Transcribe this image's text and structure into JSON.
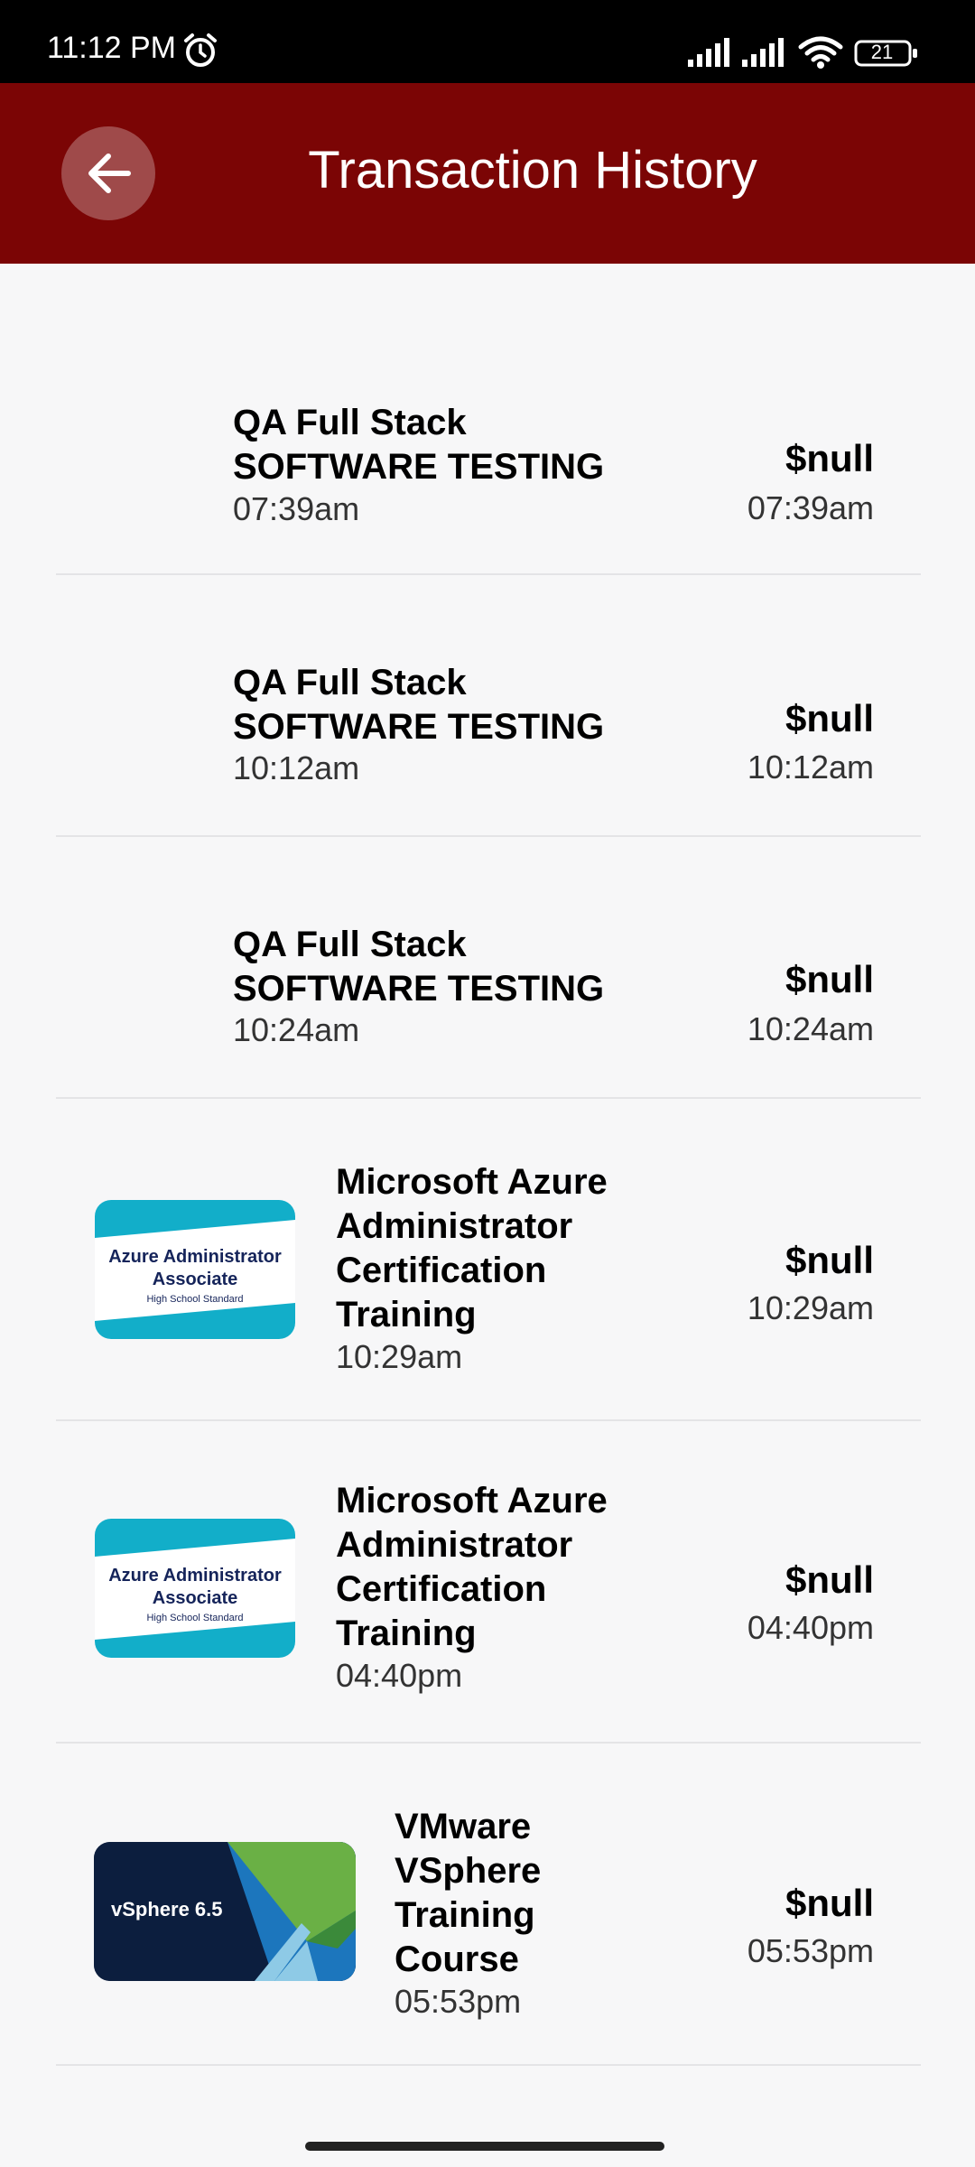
{
  "status_bar": {
    "time": "11:12 PM",
    "battery": "21",
    "icons": [
      "alarm-icon",
      "signal-icon",
      "signal-icon",
      "wifi-icon",
      "battery-icon"
    ]
  },
  "header": {
    "title": "Transaction History",
    "back_icon": "arrow-left-icon",
    "color": "#7b0505"
  },
  "transactions": [
    {
      "title": "QA Full Stack SOFTWARE TESTING",
      "time": "07:39am",
      "price": "$null",
      "right_time": "07:39am",
      "thumbnail": null
    },
    {
      "title": "QA Full Stack SOFTWARE TESTING",
      "time": "10:12am",
      "price": "$null",
      "right_time": "10:12am",
      "thumbnail": null
    },
    {
      "title": "QA Full Stack SOFTWARE TESTING",
      "time": "10:24am",
      "price": "$null",
      "right_time": "10:24am",
      "thumbnail": null
    },
    {
      "title": "Microsoft Azure Administrator Certification Training",
      "time": "10:29am",
      "price": "$null",
      "right_time": "10:29am",
      "thumbnail": {
        "line1": "Azure Administrator",
        "line2": "Associate",
        "line3": "High School Standard"
      }
    },
    {
      "title": "Microsoft Azure Administrator Certification Training",
      "time": "04:40pm",
      "price": "$null",
      "right_time": "04:40pm",
      "thumbnail": {
        "line1": "Azure Administrator",
        "line2": "Associate",
        "line3": "High School Standard"
      }
    },
    {
      "title": "VMware VSphere Training Course",
      "time": "05:53pm",
      "price": "$null",
      "right_time": "05:53pm",
      "thumbnail": {
        "line1": "vSphere 6.5"
      }
    }
  ]
}
